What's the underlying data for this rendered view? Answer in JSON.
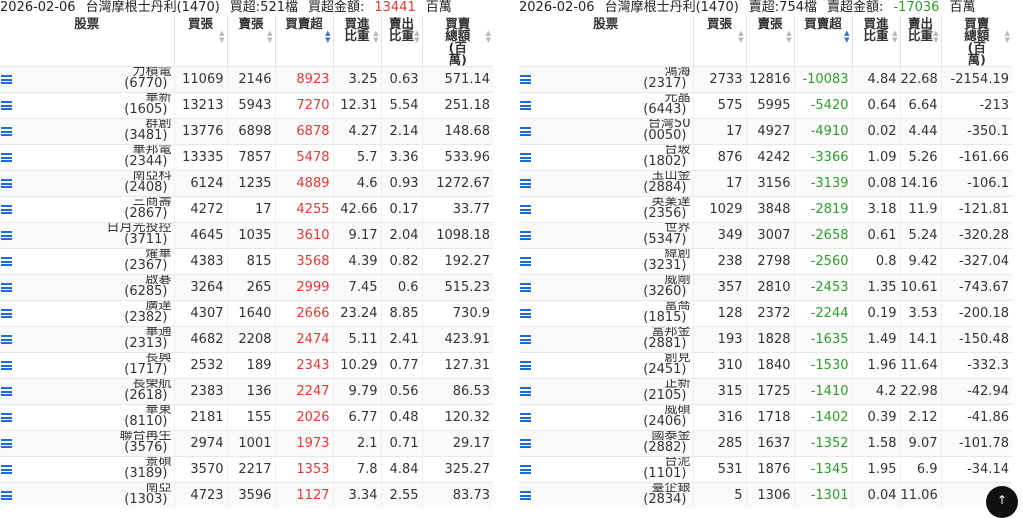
{
  "left": {
    "header": {
      "date": "2026-02-06",
      "broker": "台灣摩根士丹利(1470)",
      "count_label": "買超:521檔",
      "amount_label": "買超金額:",
      "amount_value": "13441",
      "amount_unit": "百萬"
    },
    "columns": [
      "股票",
      "買張",
      "賣張",
      "買賣超",
      "買進比重",
      "賣出比重",
      "買賣總額(百萬)"
    ],
    "rows": [
      {
        "name": "力積電",
        "code": "(6770)",
        "buy": "11069",
        "sell": "2146",
        "net": "8923",
        "buy_pct": "3.25",
        "sell_pct": "0.63",
        "total": "571.14"
      },
      {
        "name": "華新",
        "code": "(1605)",
        "buy": "13213",
        "sell": "5943",
        "net": "7270",
        "buy_pct": "12.31",
        "sell_pct": "5.54",
        "total": "251.18"
      },
      {
        "name": "群創",
        "code": "(3481)",
        "buy": "13776",
        "sell": "6898",
        "net": "6878",
        "buy_pct": "4.27",
        "sell_pct": "2.14",
        "total": "148.68"
      },
      {
        "name": "華邦電",
        "code": "(2344)",
        "buy": "13335",
        "sell": "7857",
        "net": "5478",
        "buy_pct": "5.7",
        "sell_pct": "3.36",
        "total": "533.96"
      },
      {
        "name": "南亞科",
        "code": "(2408)",
        "buy": "6124",
        "sell": "1235",
        "net": "4889",
        "buy_pct": "4.6",
        "sell_pct": "0.93",
        "total": "1272.67"
      },
      {
        "name": "三商壽",
        "code": "(2867)",
        "buy": "4272",
        "sell": "17",
        "net": "4255",
        "buy_pct": "42.66",
        "sell_pct": "0.17",
        "total": "33.77"
      },
      {
        "name": "日月光投控",
        "code": "(3711)",
        "buy": "4645",
        "sell": "1035",
        "net": "3610",
        "buy_pct": "9.17",
        "sell_pct": "2.04",
        "total": "1098.18"
      },
      {
        "name": "燿華",
        "code": "(2367)",
        "buy": "4383",
        "sell": "815",
        "net": "3568",
        "buy_pct": "4.39",
        "sell_pct": "0.82",
        "total": "192.27"
      },
      {
        "name": "啟碁",
        "code": "(6285)",
        "buy": "3264",
        "sell": "265",
        "net": "2999",
        "buy_pct": "7.45",
        "sell_pct": "0.6",
        "total": "515.23"
      },
      {
        "name": "廣達",
        "code": "(2382)",
        "buy": "4307",
        "sell": "1640",
        "net": "2666",
        "buy_pct": "23.24",
        "sell_pct": "8.85",
        "total": "730.9"
      },
      {
        "name": "華通",
        "code": "(2313)",
        "buy": "4682",
        "sell": "2208",
        "net": "2474",
        "buy_pct": "5.11",
        "sell_pct": "2.41",
        "total": "423.91"
      },
      {
        "name": "長興",
        "code": "(1717)",
        "buy": "2532",
        "sell": "189",
        "net": "2343",
        "buy_pct": "10.29",
        "sell_pct": "0.77",
        "total": "127.31"
      },
      {
        "name": "長榮航",
        "code": "(2618)",
        "buy": "2383",
        "sell": "136",
        "net": "2247",
        "buy_pct": "9.79",
        "sell_pct": "0.56",
        "total": "86.53"
      },
      {
        "name": "華東",
        "code": "(8110)",
        "buy": "2181",
        "sell": "155",
        "net": "2026",
        "buy_pct": "6.77",
        "sell_pct": "0.48",
        "total": "120.32"
      },
      {
        "name": "聯合再生",
        "code": "(3576)",
        "buy": "2974",
        "sell": "1001",
        "net": "1973",
        "buy_pct": "2.1",
        "sell_pct": "0.71",
        "total": "29.17"
      },
      {
        "name": "景碩",
        "code": "(3189)",
        "buy": "3570",
        "sell": "2217",
        "net": "1353",
        "buy_pct": "7.8",
        "sell_pct": "4.84",
        "total": "325.27"
      },
      {
        "name": "南亞",
        "code": "(1303)",
        "buy": "4723",
        "sell": "3596",
        "net": "1127",
        "buy_pct": "3.34",
        "sell_pct": "2.55",
        "total": "83.73"
      }
    ]
  },
  "right": {
    "header": {
      "date": "2026-02-06",
      "broker": "台灣摩根士丹利(1470)",
      "count_label": "賣超:754檔",
      "amount_label": "賣超金額:",
      "amount_value": "-17036",
      "amount_unit": "百萬"
    },
    "columns": [
      "股票",
      "買張",
      "賣張",
      "買賣超",
      "買進比重",
      "賣出比重",
      "買賣總額(百萬)"
    ],
    "rows": [
      {
        "name": "鴻海",
        "code": "(2317)",
        "buy": "2733",
        "sell": "12816",
        "net": "-10083",
        "buy_pct": "4.84",
        "sell_pct": "22.68",
        "total": "-2154.19"
      },
      {
        "name": "元晶",
        "code": "(6443)",
        "buy": "575",
        "sell": "5995",
        "net": "-5420",
        "buy_pct": "0.64",
        "sell_pct": "6.64",
        "total": "-213"
      },
      {
        "name": "台灣50",
        "code": "(0050)",
        "buy": "17",
        "sell": "4927",
        "net": "-4910",
        "buy_pct": "0.02",
        "sell_pct": "4.44",
        "total": "-350.1"
      },
      {
        "name": "台玻",
        "code": "(1802)",
        "buy": "876",
        "sell": "4242",
        "net": "-3366",
        "buy_pct": "1.09",
        "sell_pct": "5.26",
        "total": "-161.66"
      },
      {
        "name": "玉山金",
        "code": "(2884)",
        "buy": "17",
        "sell": "3156",
        "net": "-3139",
        "buy_pct": "0.08",
        "sell_pct": "14.16",
        "total": "-106.1"
      },
      {
        "name": "英業達",
        "code": "(2356)",
        "buy": "1029",
        "sell": "3848",
        "net": "-2819",
        "buy_pct": "3.18",
        "sell_pct": "11.9",
        "total": "-121.81"
      },
      {
        "name": "世界",
        "code": "(5347)",
        "buy": "349",
        "sell": "3007",
        "net": "-2658",
        "buy_pct": "0.61",
        "sell_pct": "5.24",
        "total": "-320.28"
      },
      {
        "name": "緯創",
        "code": "(3231)",
        "buy": "238",
        "sell": "2798",
        "net": "-2560",
        "buy_pct": "0.8",
        "sell_pct": "9.42",
        "total": "-327.04"
      },
      {
        "name": "威剛",
        "code": "(3260)",
        "buy": "357",
        "sell": "2810",
        "net": "-2453",
        "buy_pct": "1.35",
        "sell_pct": "10.61",
        "total": "-743.67"
      },
      {
        "name": "富喬",
        "code": "(1815)",
        "buy": "128",
        "sell": "2372",
        "net": "-2244",
        "buy_pct": "0.19",
        "sell_pct": "3.53",
        "total": "-200.18"
      },
      {
        "name": "富邦金",
        "code": "(2881)",
        "buy": "193",
        "sell": "1828",
        "net": "-1635",
        "buy_pct": "1.49",
        "sell_pct": "14.1",
        "total": "-150.48"
      },
      {
        "name": "創見",
        "code": "(2451)",
        "buy": "310",
        "sell": "1840",
        "net": "-1530",
        "buy_pct": "1.96",
        "sell_pct": "11.64",
        "total": "-332.3"
      },
      {
        "name": "正新",
        "code": "(2105)",
        "buy": "315",
        "sell": "1725",
        "net": "-1410",
        "buy_pct": "4.2",
        "sell_pct": "22.98",
        "total": "-42.94"
      },
      {
        "name": "威碩",
        "code": "(2406)",
        "buy": "316",
        "sell": "1718",
        "net": "-1402",
        "buy_pct": "0.39",
        "sell_pct": "2.12",
        "total": "-41.86"
      },
      {
        "name": "國泰金",
        "code": "(2882)",
        "buy": "285",
        "sell": "1637",
        "net": "-1352",
        "buy_pct": "1.58",
        "sell_pct": "9.07",
        "total": "-101.78"
      },
      {
        "name": "台泥",
        "code": "(1101)",
        "buy": "531",
        "sell": "1876",
        "net": "-1345",
        "buy_pct": "1.95",
        "sell_pct": "6.9",
        "total": "-34.14"
      },
      {
        "name": "臺企銀",
        "code": "(2834)",
        "buy": "5",
        "sell": "1306",
        "net": "-1301",
        "buy_pct": "0.04",
        "sell_pct": "11.06",
        "total": "-2"
      }
    ]
  },
  "colors": {
    "positive": "#e53935",
    "negative": "#2e9e2e",
    "icon": "#1e6ad9"
  },
  "icons": {
    "row_menu": "list-icon",
    "sort": "sort-arrows-icon",
    "scroll": "scroll-up-icon"
  }
}
